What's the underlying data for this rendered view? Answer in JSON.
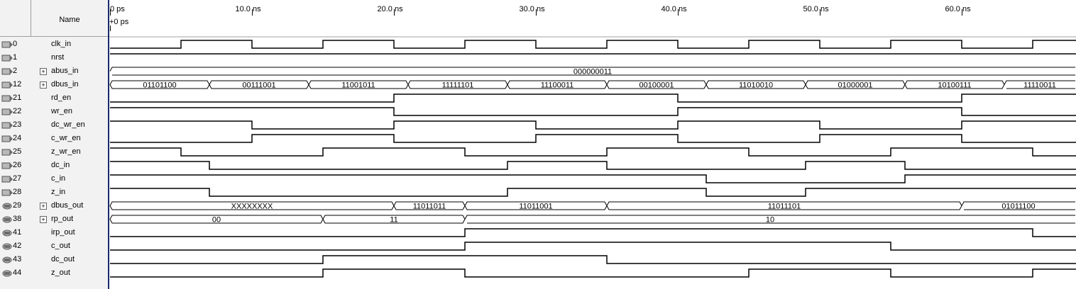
{
  "header": {
    "name_label": "Name",
    "cursor_label": "+0 ps"
  },
  "ruler": {
    "ticks": [
      {
        "label": "0 ps",
        "t": 0
      },
      {
        "label": "10.0 ns",
        "t": 10
      },
      {
        "label": "20.0 ns",
        "t": 20
      },
      {
        "label": "30.0 ns",
        "t": 30
      },
      {
        "label": "40.0 ns",
        "t": 40
      },
      {
        "label": "50.0 ns",
        "t": 50
      },
      {
        "label": "60.0 ns",
        "t": 60
      }
    ]
  },
  "colors": {
    "wave": "#000000",
    "separator": "#1a2a6c",
    "grid": "#c0c0c0",
    "panel": "#f2f2f2"
  },
  "signals": [
    {
      "index": "0",
      "name": "clk_in",
      "dir": "input",
      "bus": false,
      "kind": "bit",
      "init": 0,
      "edges": [
        5,
        10,
        15,
        20,
        25,
        30,
        35,
        40,
        45,
        50,
        55,
        60,
        65
      ]
    },
    {
      "index": "1",
      "name": "nrst",
      "dir": "input",
      "bus": false,
      "kind": "bit",
      "init": 1,
      "edges": []
    },
    {
      "index": "2",
      "name": "abus_in",
      "dir": "input",
      "bus": true,
      "kind": "bus",
      "segments": [
        {
          "t0": 0,
          "t1": 68,
          "v": "000000011"
        }
      ]
    },
    {
      "index": "12",
      "name": "dbus_in",
      "dir": "input",
      "bus": true,
      "kind": "bus",
      "segments": [
        {
          "t0": 0,
          "t1": 7,
          "v": "01101100"
        },
        {
          "t0": 7,
          "t1": 14,
          "v": "00111001"
        },
        {
          "t0": 14,
          "t1": 21,
          "v": "11001011"
        },
        {
          "t0": 21,
          "t1": 28,
          "v": "11111101"
        },
        {
          "t0": 28,
          "t1": 35,
          "v": "11100011"
        },
        {
          "t0": 35,
          "t1": 42,
          "v": "00100001"
        },
        {
          "t0": 42,
          "t1": 49,
          "v": "11010010"
        },
        {
          "t0": 49,
          "t1": 56,
          "v": "01000001"
        },
        {
          "t0": 56,
          "t1": 63,
          "v": "10100111"
        },
        {
          "t0": 63,
          "t1": 68,
          "v": "11110011"
        }
      ]
    },
    {
      "index": "21",
      "name": "rd_en",
      "dir": "input",
      "bus": false,
      "kind": "bit",
      "init": 0,
      "edges": [
        20,
        40,
        60
      ]
    },
    {
      "index": "22",
      "name": "wr_en",
      "dir": "input",
      "bus": false,
      "kind": "bit",
      "init": 1,
      "edges": [
        20,
        40,
        60
      ]
    },
    {
      "index": "23",
      "name": "dc_wr_en",
      "dir": "input",
      "bus": false,
      "kind": "bit",
      "init": 1,
      "edges": [
        10,
        20,
        30,
        40,
        50,
        60
      ]
    },
    {
      "index": "24",
      "name": "c_wr_en",
      "dir": "input",
      "bus": false,
      "kind": "bit",
      "init": 0,
      "edges": [
        10,
        20,
        30,
        40,
        50,
        60
      ]
    },
    {
      "index": "25",
      "name": "z_wr_en",
      "dir": "input",
      "bus": false,
      "kind": "bit",
      "init": 1,
      "edges": [
        5,
        15,
        25,
        35,
        45,
        55,
        65
      ]
    },
    {
      "index": "26",
      "name": "dc_in",
      "dir": "input",
      "bus": false,
      "kind": "bit",
      "init": 1,
      "edges": [
        7,
        28,
        35,
        49,
        56
      ]
    },
    {
      "index": "27",
      "name": "c_in",
      "dir": "input",
      "bus": false,
      "kind": "bit",
      "init": 1,
      "edges": [
        42,
        56
      ]
    },
    {
      "index": "28",
      "name": "z_in",
      "dir": "input",
      "bus": false,
      "kind": "bit",
      "init": 1,
      "edges": [
        7,
        28,
        42,
        49
      ]
    },
    {
      "index": "29",
      "name": "dbus_out",
      "dir": "output",
      "bus": true,
      "kind": "bus",
      "segments": [
        {
          "t0": 0,
          "t1": 20,
          "v": "XXXXXXXX"
        },
        {
          "t0": 20,
          "t1": 25,
          "v": "11011011"
        },
        {
          "t0": 25,
          "t1": 35,
          "v": "11011001"
        },
        {
          "t0": 35,
          "t1": 60,
          "v": "11011101"
        },
        {
          "t0": 60,
          "t1": 68,
          "v": "01011100"
        }
      ]
    },
    {
      "index": "38",
      "name": "rp_out",
      "dir": "output",
      "bus": true,
      "kind": "bus",
      "segments": [
        {
          "t0": 0,
          "t1": 15,
          "v": "00"
        },
        {
          "t0": 15,
          "t1": 25,
          "v": "11"
        },
        {
          "t0": 25,
          "t1": 68,
          "v": "10"
        }
      ]
    },
    {
      "index": "41",
      "name": "irp_out",
      "dir": "output",
      "bus": false,
      "kind": "bit",
      "init": 0,
      "edges": [
        25,
        65
      ]
    },
    {
      "index": "42",
      "name": "c_out",
      "dir": "output",
      "bus": false,
      "kind": "bit",
      "init": 0,
      "edges": [
        25,
        55
      ]
    },
    {
      "index": "43",
      "name": "dc_out",
      "dir": "output",
      "bus": false,
      "kind": "bit",
      "init": 0,
      "edges": [
        15,
        35
      ]
    },
    {
      "index": "44",
      "name": "z_out",
      "dir": "output",
      "bus": false,
      "kind": "bit",
      "init": 0,
      "edges": [
        15,
        25,
        45,
        55,
        65
      ]
    }
  ]
}
